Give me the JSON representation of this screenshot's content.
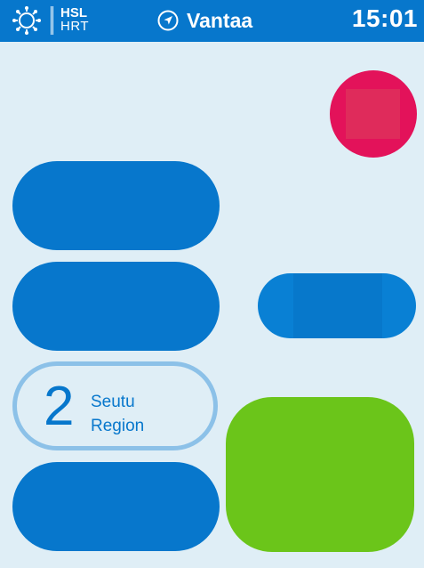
{
  "header": {
    "settings_icon": "settings-gear-icon",
    "logo": {
      "line1": "HSL",
      "line2": "HRT"
    },
    "location": {
      "icon": "location-arrow-icon",
      "name": "Vantaa"
    },
    "clock": "15:01"
  },
  "zone": {
    "number": "2",
    "label_fi": "Seutu",
    "label_sv": "Region"
  },
  "colors": {
    "header_bg": "#0777cc",
    "page_bg": "#dfeef6",
    "primary_blue": "#0777cc",
    "stop_red": "#e3125a",
    "go_green": "#6bc51a",
    "zone_border": "#8cc1e8"
  }
}
